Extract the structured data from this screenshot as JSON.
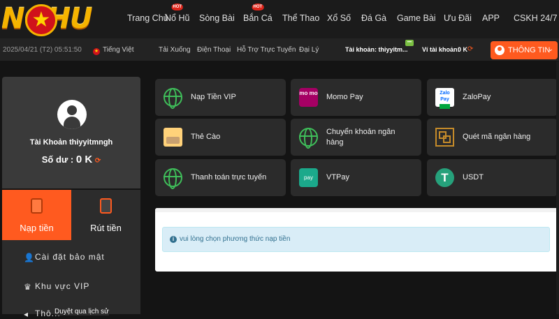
{
  "brand": {
    "logo_text": "NOHU"
  },
  "nav": {
    "items": [
      {
        "label": "Trang Chủ",
        "hot": false
      },
      {
        "label": "Nổ Hũ",
        "hot": true
      },
      {
        "label": "Sòng Bài",
        "hot": false
      },
      {
        "label": "Bắn Cá",
        "hot": true
      },
      {
        "label": "Thể Thao",
        "hot": false
      },
      {
        "label": "Xổ Số",
        "hot": false
      },
      {
        "label": "Đá Gà",
        "hot": false
      },
      {
        "label": "Game Bài",
        "hot": false
      },
      {
        "label": "Ưu Đãi",
        "hot": false
      },
      {
        "label": "APP",
        "hot": false
      },
      {
        "label": "CSKH 24/7",
        "hot": false
      }
    ],
    "hot_badge": "HOT"
  },
  "subbar": {
    "datetime": "2025/04/21 (T2) 05:51:50",
    "language": "Tiếng Việt",
    "links": [
      "Tải Xuống",
      "Điện Thoại",
      "Hỗ Trợ Trực Tuyến",
      "Đại Lý"
    ],
    "account_label": "Tài khoản: thiyyitm...",
    "wallet_label": "Ví tài khoản:",
    "wallet_value": "0 K",
    "info_button": "THÔNG TIN"
  },
  "profile": {
    "account_name": "Tài Khoản thiyyitmngh",
    "balance_label": "Số dư :",
    "balance_value": "0 K"
  },
  "tabs": {
    "deposit": "Nạp tiền",
    "withdraw": "Rút tiền"
  },
  "side_menu": {
    "items": [
      "Cài đặt bảo mật",
      "Khu vực VIP",
      "Thô..."
    ],
    "tooltip": "Duyệt qua lịch sử"
  },
  "payments": [
    {
      "label": "Nạp Tiền VIP",
      "icon": "globe-icon"
    },
    {
      "label": "Momo Pay",
      "icon": "momo-icon",
      "icon_text": "mo mo"
    },
    {
      "label": "ZaloPay",
      "icon": "zalopay-icon",
      "icon_text": "Zalo Pay"
    },
    {
      "label": "Thẻ Cào",
      "icon": "scratch-card-icon"
    },
    {
      "label": "Chuyển khoản ngân hàng",
      "icon": "globe-icon"
    },
    {
      "label": "Quét mã ngân hàng",
      "icon": "qr-code-icon"
    },
    {
      "label": "Thanh toán trực tuyến",
      "icon": "globe-icon"
    },
    {
      "label": "VTPay",
      "icon": "vtpay-icon",
      "icon_text": "pay"
    },
    {
      "label": "USDT",
      "icon": "usdt-icon",
      "icon_text": "T"
    }
  ],
  "notice": {
    "message": "vui lòng chọn phương thức nạp tiền"
  },
  "colors": {
    "accent": "#ff5a1f",
    "background": "#141414",
    "panel": "#2b2b2b",
    "globe": "#3fbf5a",
    "alert_bg": "#d9edf7",
    "alert_text": "#31708f"
  }
}
